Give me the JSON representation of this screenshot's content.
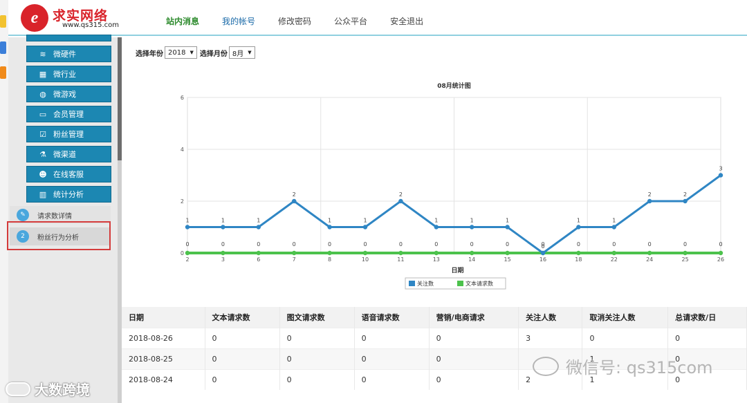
{
  "header": {
    "logo_text": "求实网络",
    "logo_url": "www.qs315.com",
    "nav": [
      "站内消息",
      "我的帐号",
      "修改密码",
      "公众平台",
      "安全退出"
    ]
  },
  "sidebar": {
    "buttons": [
      "微硬件",
      "微行业",
      "微游戏",
      "会员管理",
      "粉丝管理",
      "微渠道",
      "在线客服",
      "统计分析"
    ],
    "sub_items": [
      {
        "num": "",
        "label": "请求数详情"
      },
      {
        "num": "2",
        "label": "粉丝行为分析"
      }
    ]
  },
  "filters": {
    "year_label": "选择年份",
    "year_value": "2018",
    "month_label": "选择月份",
    "month_value": "8月"
  },
  "chart_data": {
    "type": "line",
    "title": "08月统计图",
    "xlabel": "日期",
    "ylabel": "",
    "ylim": [
      0,
      6
    ],
    "yticks": [
      0,
      2,
      4,
      6
    ],
    "categories": [
      "2",
      "3",
      "6",
      "7",
      "8",
      "10",
      "11",
      "13",
      "14",
      "15",
      "16",
      "18",
      "22",
      "24",
      "25",
      "26"
    ],
    "series": [
      {
        "name": "关注数",
        "color": "#2f86c4",
        "values": [
          1,
          1,
          1,
          2,
          1,
          1,
          2,
          1,
          1,
          1,
          0,
          1,
          1,
          2,
          2,
          3
        ]
      },
      {
        "name": "文本请求数",
        "color": "#4cc24c",
        "values": [
          0,
          0,
          0,
          0,
          0,
          0,
          0,
          0,
          0,
          0,
          0,
          0,
          0,
          0,
          0,
          0
        ]
      }
    ],
    "legend": "bottom-center",
    "grid": true
  },
  "table": {
    "headers": [
      "日期",
      "文本请求数",
      "图文请求数",
      "语音请求数",
      "营销/电商请求",
      "关注人数",
      "取消关注人数",
      "总请求数/日"
    ],
    "rows": [
      [
        "2018-08-26",
        "0",
        "0",
        "0",
        "0",
        "3",
        "0",
        "0"
      ],
      [
        "2018-08-25",
        "0",
        "0",
        "0",
        "0",
        "",
        "1",
        "0"
      ],
      [
        "2018-08-24",
        "0",
        "0",
        "0",
        "0",
        "2",
        "1",
        "0"
      ]
    ]
  },
  "watermarks": {
    "right": "微信号: qs315com",
    "left": "大数跨境"
  }
}
